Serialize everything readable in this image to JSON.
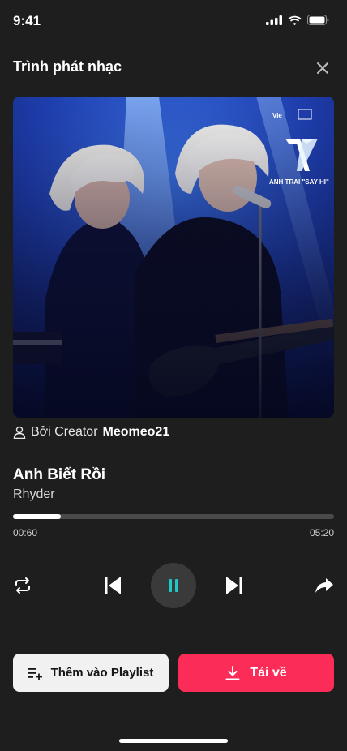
{
  "status_bar": {
    "time": "9:41"
  },
  "header": {
    "title": "Trình phát nhạc"
  },
  "artwork": {
    "brand_text": "Vie",
    "show_name": "ANH TRAI \"SAY HI\""
  },
  "creator": {
    "prefix": "Bởi Creator",
    "name": "Meomeo21"
  },
  "track": {
    "title": "Anh Biết Rồi",
    "artist": "Rhyder"
  },
  "playback": {
    "elapsed": "00:60",
    "duration": "05:20",
    "progress": 0.15
  },
  "actions": {
    "add_playlist_label": "Thêm vào Playlist",
    "download_label": "Tải về"
  },
  "icons": {
    "repeat": "repeat-icon",
    "prev": "skip-previous-icon",
    "pause": "pause-icon",
    "next": "skip-next-icon",
    "share": "share-icon",
    "user": "user-icon",
    "close": "close-icon",
    "add_playlist": "playlist-add-icon",
    "download": "download-icon"
  },
  "colors": {
    "background": "#1e1e1e",
    "accent": "#fb2c57",
    "pause_accent": "#1ec8c8"
  }
}
